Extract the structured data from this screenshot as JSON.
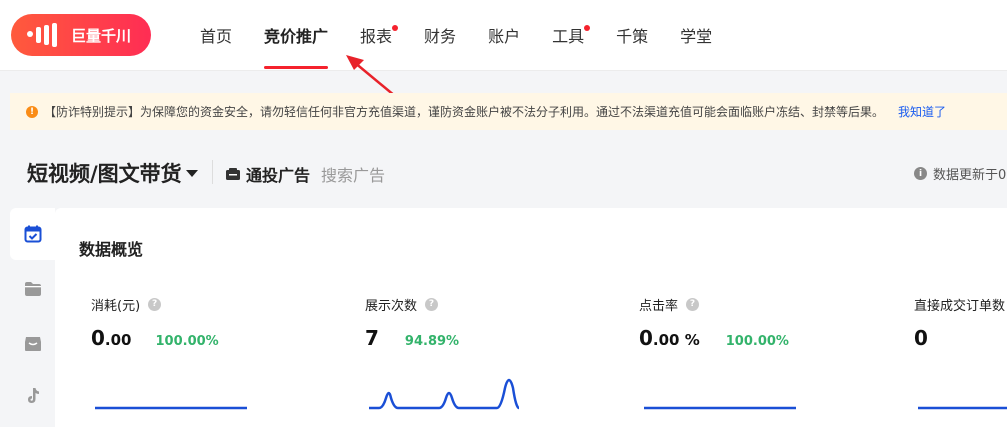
{
  "logo": {
    "text": "巨量千川"
  },
  "nav": {
    "items": [
      {
        "label": "首页",
        "active": false,
        "dot": false
      },
      {
        "label": "竞价推广",
        "active": true,
        "dot": false
      },
      {
        "label": "报表",
        "active": false,
        "dot": true
      },
      {
        "label": "财务",
        "active": false,
        "dot": false
      },
      {
        "label": "账户",
        "active": false,
        "dot": false
      },
      {
        "label": "工具",
        "active": false,
        "dot": true
      },
      {
        "label": "千策",
        "active": false,
        "dot": false
      },
      {
        "label": "学堂",
        "active": false,
        "dot": false
      }
    ]
  },
  "notice": {
    "icon": "warning-icon",
    "text": "【防诈特别提示】为保障您的资金安全，请勿轻信任何非官方充值渠道，谨防资金账户被不法分子利用。通过不法渠道充值可能会面临账户冻结、封禁等后果。",
    "link": "我知道了"
  },
  "header": {
    "scope": "短视频/图文带货",
    "tabs": [
      "通投广告",
      "搜索广告"
    ],
    "updated": "数据更新于0"
  },
  "overview": {
    "title": "数据概览",
    "metrics": [
      {
        "name": "消耗(元)",
        "value": "0",
        "sub": ".00",
        "suffix": "",
        "change": "100.00%"
      },
      {
        "name": "展示次数",
        "value": "7",
        "sub": "",
        "suffix": "",
        "change": "94.89%"
      },
      {
        "name": "点击率",
        "value": "0",
        "sub": ".00",
        "suffix": " %",
        "change": "100.00%"
      },
      {
        "name": "直接成交订单数",
        "value": "0",
        "sub": "",
        "suffix": "",
        "change": ""
      }
    ]
  },
  "colors": {
    "accent": "#f5222d",
    "brand": "#ff3a4a",
    "positive": "#33b36b",
    "line": "#1a4fd6",
    "link": "#1a5cf0"
  }
}
